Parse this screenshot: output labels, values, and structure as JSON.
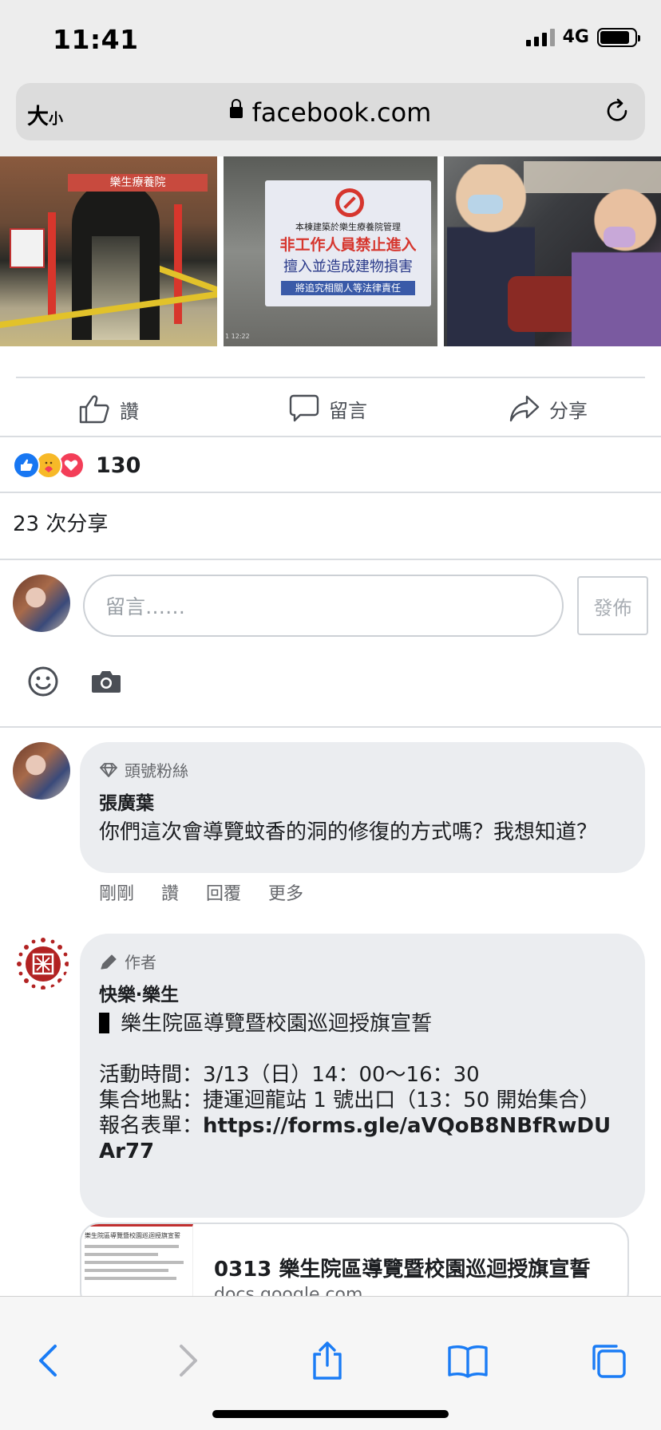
{
  "status_bar": {
    "time": "11:41",
    "network": "4G",
    "battery_level": 0.85
  },
  "browser": {
    "text_size_label_big": "大",
    "text_size_label_small": "小",
    "url": "facebook.com"
  },
  "post_actions": {
    "like": "讚",
    "comment": "留言",
    "share": "分享"
  },
  "reactions": {
    "count": "130",
    "types": [
      "like",
      "care",
      "love"
    ]
  },
  "shares_text": "23 次分享",
  "composer": {
    "placeholder": "留言……",
    "post_button": "發佈"
  },
  "comments": [
    {
      "badge": "頭號粉絲",
      "name": "張廣葉",
      "text": "你們這次會導覽蚊香的洞的修復的方式嗎？我想知道？",
      "meta": [
        "剛剛",
        "讚",
        "回覆",
        "更多"
      ]
    },
    {
      "badge": "作者",
      "name": "快樂‧樂生",
      "title": "樂生院區導覽暨校園巡迴授旗宣誓",
      "time_line": "活動時間：3/13（日）14：00～16：30",
      "place_line": "集合地點：捷運迴龍站 1 號出口（13：50 開始集合）",
      "form_label": "報名表單：",
      "form_url": "https://forms.gle/aVQoB8NBfRwDUAr77",
      "link_preview": {
        "title": "0313 樂生院區導覽暨校園巡迴授旗宣誓",
        "domain": "docs.google.com",
        "thumb_title": "樂生院區導覽暨校園巡迴授旗宣誓"
      }
    }
  ],
  "photos": {
    "photo1_banner": "樂生療養院",
    "sign": {
      "line1": "本棟建築於樂生療養院管理",
      "line2": "非工作人員禁止進入",
      "line3": "擅入並造成建物損害",
      "line4": "將追究相關人等法律責任",
      "timestamp": "1 12:22"
    }
  },
  "colors": {
    "facebook_blue": "#1877f2",
    "bubble_bg": "#ebedf0",
    "muted_text": "#65676b"
  }
}
